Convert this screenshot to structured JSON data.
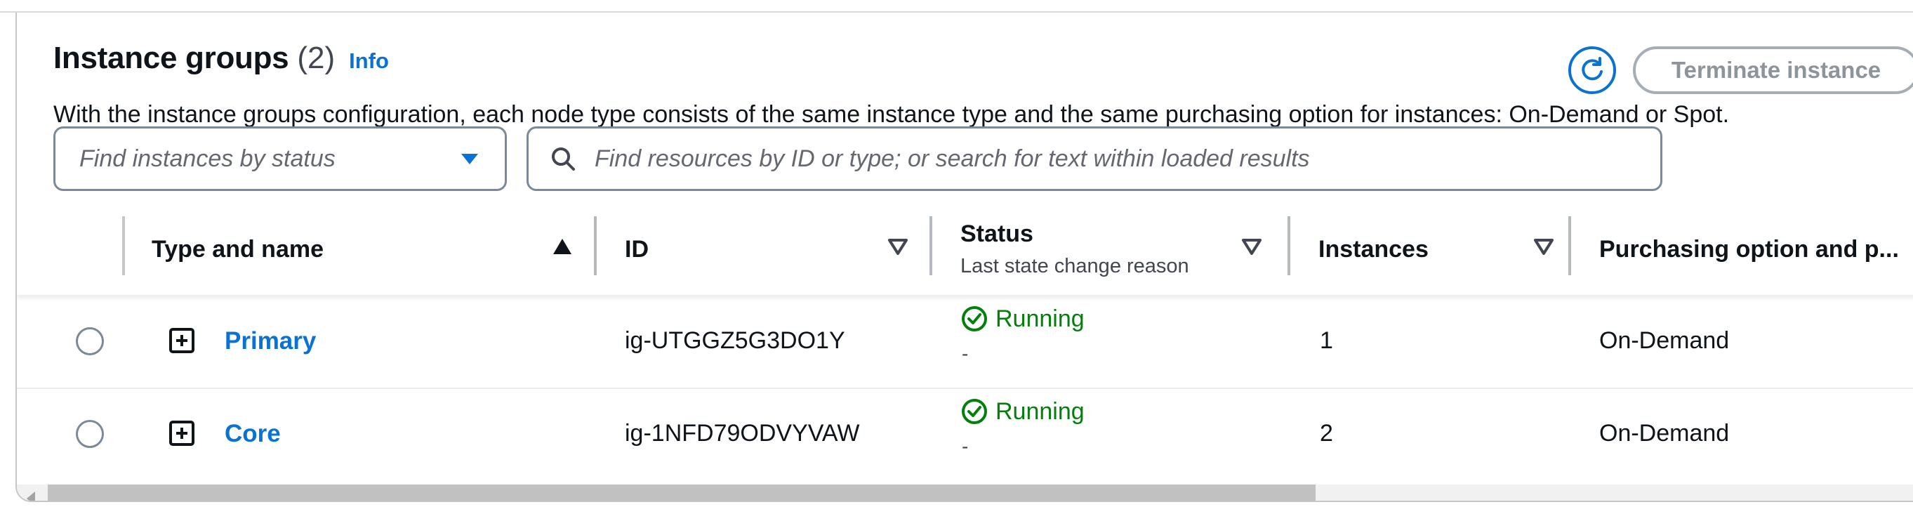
{
  "header": {
    "title": "Instance groups",
    "count": "(2)",
    "info_label": "Info",
    "description": "With the instance groups configuration, each node type consists of the same instance type and the same purchasing option for instances: On-Demand or Spot."
  },
  "actions": {
    "refresh_icon": "refresh-icon",
    "terminate_label": "Terminate instance"
  },
  "filters": {
    "status_placeholder": "Find instances by status",
    "search_placeholder": "Find resources by ID or type; or search for text within loaded results"
  },
  "table": {
    "columns": {
      "type_name": "Type and name",
      "id": "ID",
      "status": "Status",
      "status_sub": "Last state change reason",
      "instances": "Instances",
      "purchasing": "Purchasing option and p..."
    },
    "sort": {
      "column": "Type and name",
      "direction": "ascending"
    },
    "rows": [
      {
        "name": "Primary",
        "id": "ig-UTGGZ5G3DO1Y",
        "status": "Running",
        "reason": "-",
        "instances": "1",
        "purchasing": "On-Demand"
      },
      {
        "name": "Core",
        "id": "ig-1NFD79ODVYVAW",
        "status": "Running",
        "reason": "-",
        "instances": "2",
        "purchasing": "On-Demand"
      }
    ]
  },
  "colors": {
    "link": "#0972d3",
    "success": "#037f0c",
    "disabled": "#8d949c"
  }
}
